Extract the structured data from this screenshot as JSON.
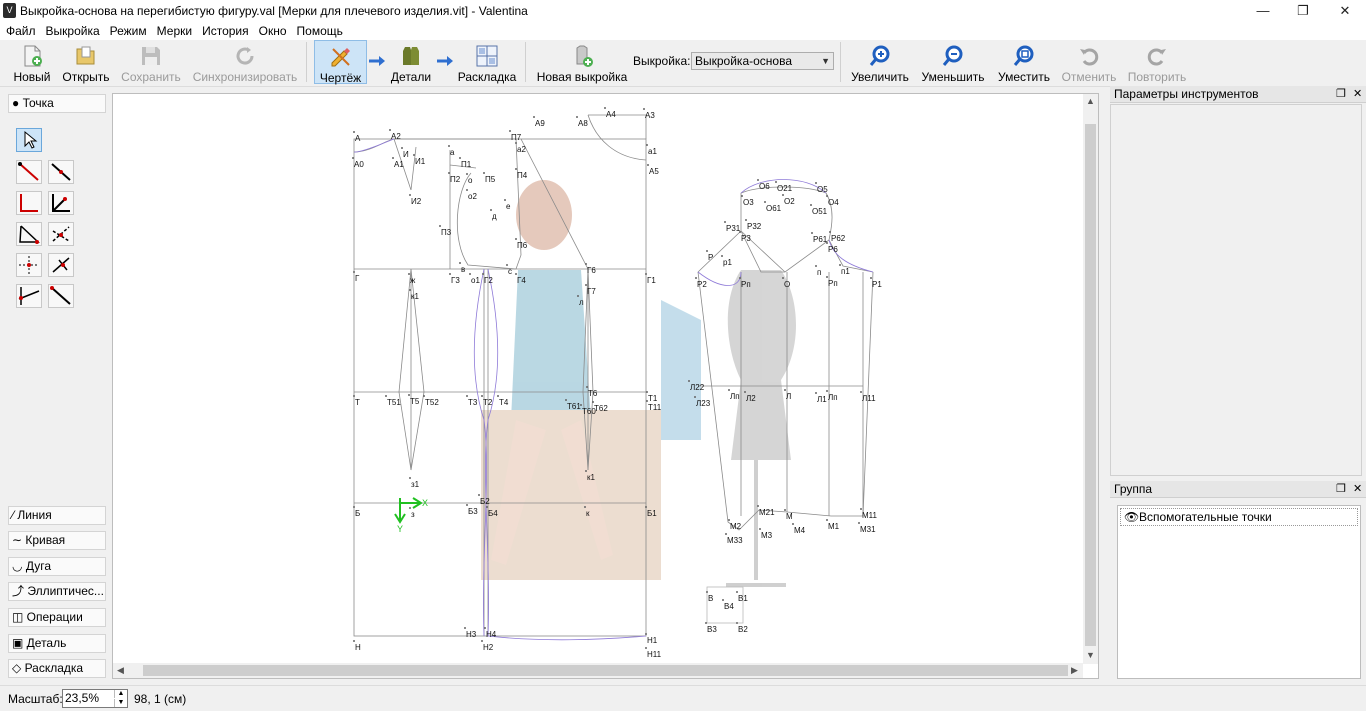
{
  "window": {
    "title": "Выкройка-основа на перегибистую фигуру.val [Мерки для плечевого изделия.vit] - Valentina",
    "app_icon": "valentina-logo-icon",
    "controls": [
      "minimize-icon",
      "maximize-icon",
      "close-icon"
    ]
  },
  "menu": [
    "Файл",
    "Выкройка",
    "Режим",
    "Мерки",
    "История",
    "Окно",
    "Помощь"
  ],
  "toolbar": {
    "new": "Новый",
    "open": "Открыть",
    "save": "Сохранить",
    "sync": "Синхронизировать",
    "draw": "Чертёж",
    "details": "Детали",
    "layout": "Раскладка",
    "new_pattern": "Новая выкройка",
    "pattern_label": "Выкройка:",
    "pattern_value": "Выкройка-основа",
    "zoom_in": "Увеличить",
    "zoom_out": "Уменьшить",
    "fit": "Уместить",
    "undo": "Отменить",
    "redo": "Повторить"
  },
  "tools": {
    "top_group": "Точка",
    "groups": [
      "Линия",
      "Кривая",
      "Дуга",
      "Эллиптичес...",
      "Операции",
      "Деталь",
      "Раскладка"
    ]
  },
  "right_panels": {
    "tool_options_title": "Параметры инструментов",
    "group_title": "Группа",
    "group_items": [
      "Вспомогательные точки"
    ]
  },
  "status": {
    "scale_label": "Масштаб:",
    "scale_value": "23,5%",
    "coords": "98, 1 (см)"
  },
  "canvas": {
    "axis_x": "X",
    "axis_y": "Y",
    "labels": [
      "А",
      "А2",
      "А9",
      "П7",
      "А8",
      "А4",
      "А3",
      "А0",
      "А1",
      "И",
      "И1",
      "а",
      "а2",
      "а1",
      "А5",
      "П1",
      "П2",
      "о",
      "П5",
      "П4",
      "о2",
      "е",
      "д",
      "И2",
      "П3",
      "П6",
      "в",
      "с",
      "Г",
      "ж",
      "Г3",
      "о1",
      "Г2",
      "Г4",
      "Г6",
      "Г1",
      "к1",
      "л",
      "Г7",
      "Т",
      "Т51",
      "Т5",
      "Т52",
      "Т3",
      "Т2",
      "Т4",
      "Т6",
      "Т61",
      "Т60",
      "Т62",
      "Т1",
      "Т11",
      "з1",
      "к1",
      "Б",
      "з",
      "Б2",
      "Б3",
      "Б4",
      "к",
      "Б1",
      "Н3",
      "Н4",
      "Н",
      "Н2",
      "Н1",
      "Н11",
      "О6",
      "О21",
      "О5",
      "О3",
      "О2",
      "О61",
      "О4",
      "О51",
      "Р31",
      "Р32",
      "Р3",
      "Р61",
      "Р62",
      "Р6",
      "Р",
      "р1",
      "п",
      "п1",
      "Р2",
      "Рп",
      "О",
      "Рп",
      "Р1",
      "Л22",
      "Л23",
      "Лп",
      "Л2",
      "Л",
      "Л1",
      "Лп",
      "Л11",
      "М21",
      "М2",
      "М",
      "М4",
      "М3",
      "М33",
      "М1",
      "М11",
      "М31",
      "В",
      "В1",
      "В4",
      "В3",
      "В2"
    ]
  }
}
